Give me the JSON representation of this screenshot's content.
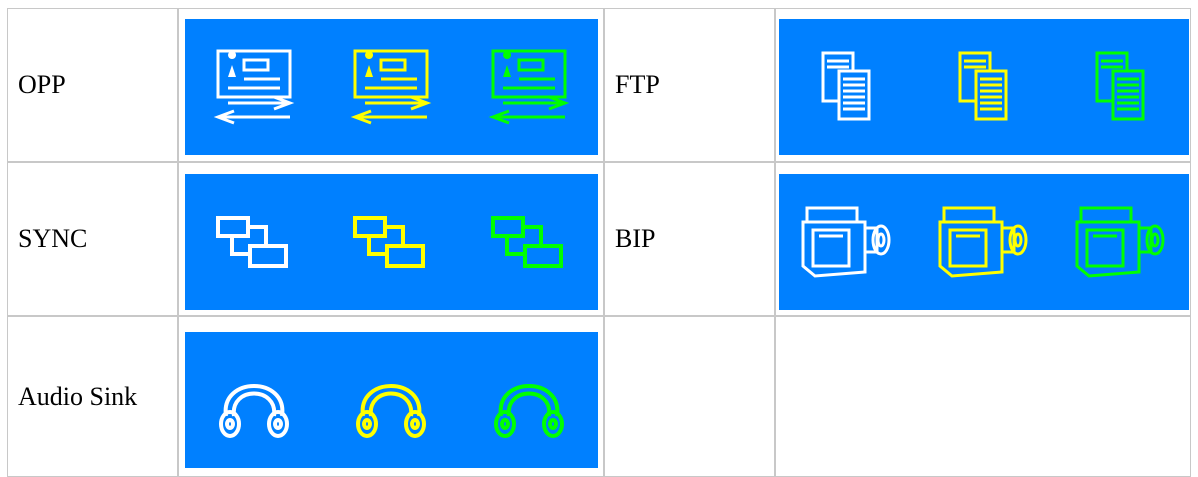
{
  "rows": [
    {
      "left": {
        "label": "OPP",
        "icon": "business-card-transfer-icon"
      },
      "right": {
        "label": "FTP",
        "icon": "documents-icon"
      }
    },
    {
      "left": {
        "label": "SYNC",
        "icon": "sync-icon"
      },
      "right": {
        "label": "BIP",
        "icon": "camera-icon"
      }
    },
    {
      "left": {
        "label": "Audio Sink",
        "icon": "headphones-icon"
      },
      "right": {
        "label": "",
        "icon": ""
      }
    }
  ],
  "icon_states": [
    "normal",
    "focused",
    "pressed"
  ],
  "colors": {
    "panel_background": "#0080ff",
    "normal": "#ffffff",
    "focused": "#ffff00",
    "pressed": "#00ff00",
    "cell_border": "#c8c8c8"
  }
}
